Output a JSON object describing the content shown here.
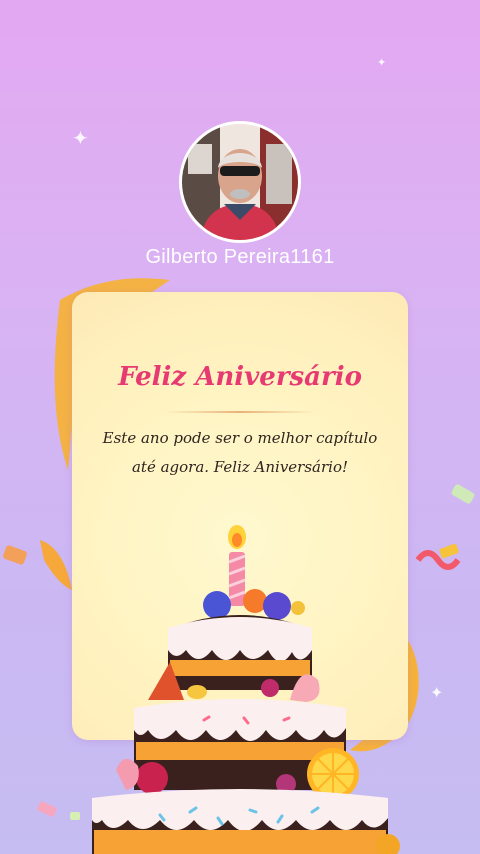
{
  "profile": {
    "username": "Gilberto Pereira1161",
    "avatar_icon": "profile-photo"
  },
  "card": {
    "title": "Feliz Aniversário",
    "message": "Este ano pode ser o melhor capítulo até agora. Feliz Aniversário!"
  },
  "decorations": {
    "ribbon_color": "#f8b23c",
    "cake_icon": "birthday-cake-icon",
    "candle_icon": "candle-icon"
  },
  "colors": {
    "title": "#e73a72",
    "background_top": "#e3a8f2",
    "background_bottom": "#c6bdf2"
  }
}
